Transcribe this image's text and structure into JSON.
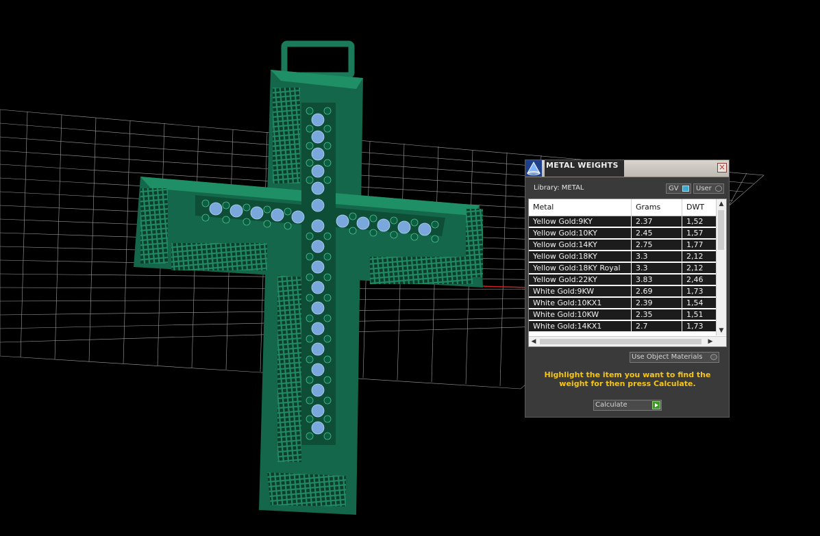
{
  "dialog": {
    "title": "METAL WEIGHTS",
    "library_label": "Library: METAL",
    "gv_toggle": "GV",
    "user_toggle": "User",
    "columns": [
      "Metal",
      "Grams",
      "DWT"
    ],
    "rows": [
      {
        "metal": "Yellow Gold:9KY",
        "grams": "2.37",
        "dwt": "1,52"
      },
      {
        "metal": "Yellow Gold:10KY",
        "grams": "2.45",
        "dwt": "1,57"
      },
      {
        "metal": "Yellow Gold:14KY",
        "grams": "2.75",
        "dwt": "1,77"
      },
      {
        "metal": "Yellow Gold:18KY",
        "grams": "3.3",
        "dwt": "2,12"
      },
      {
        "metal": "Yellow Gold:18KY Royal",
        "grams": "3.3",
        "dwt": "2,12"
      },
      {
        "metal": "Yellow Gold:22KY",
        "grams": "3.83",
        "dwt": "2,46"
      },
      {
        "metal": "White Gold:9KW",
        "grams": "2.69",
        "dwt": "1,73"
      },
      {
        "metal": "White Gold:10KX1",
        "grams": "2.39",
        "dwt": "1,54"
      },
      {
        "metal": "White Gold:10KW",
        "grams": "2.35",
        "dwt": "1,51"
      },
      {
        "metal": "White Gold:14KX1",
        "grams": "2.7",
        "dwt": "1,73"
      }
    ],
    "use_object_materials": "Use Object Materials",
    "instructions": "Highlight the item you want to find the weight for then press Calculate.",
    "calculate_label": "Calculate"
  },
  "colors": {
    "model": "#1a7a5a",
    "gem": "#7aa8dd",
    "accent_text": "#f5c518"
  }
}
